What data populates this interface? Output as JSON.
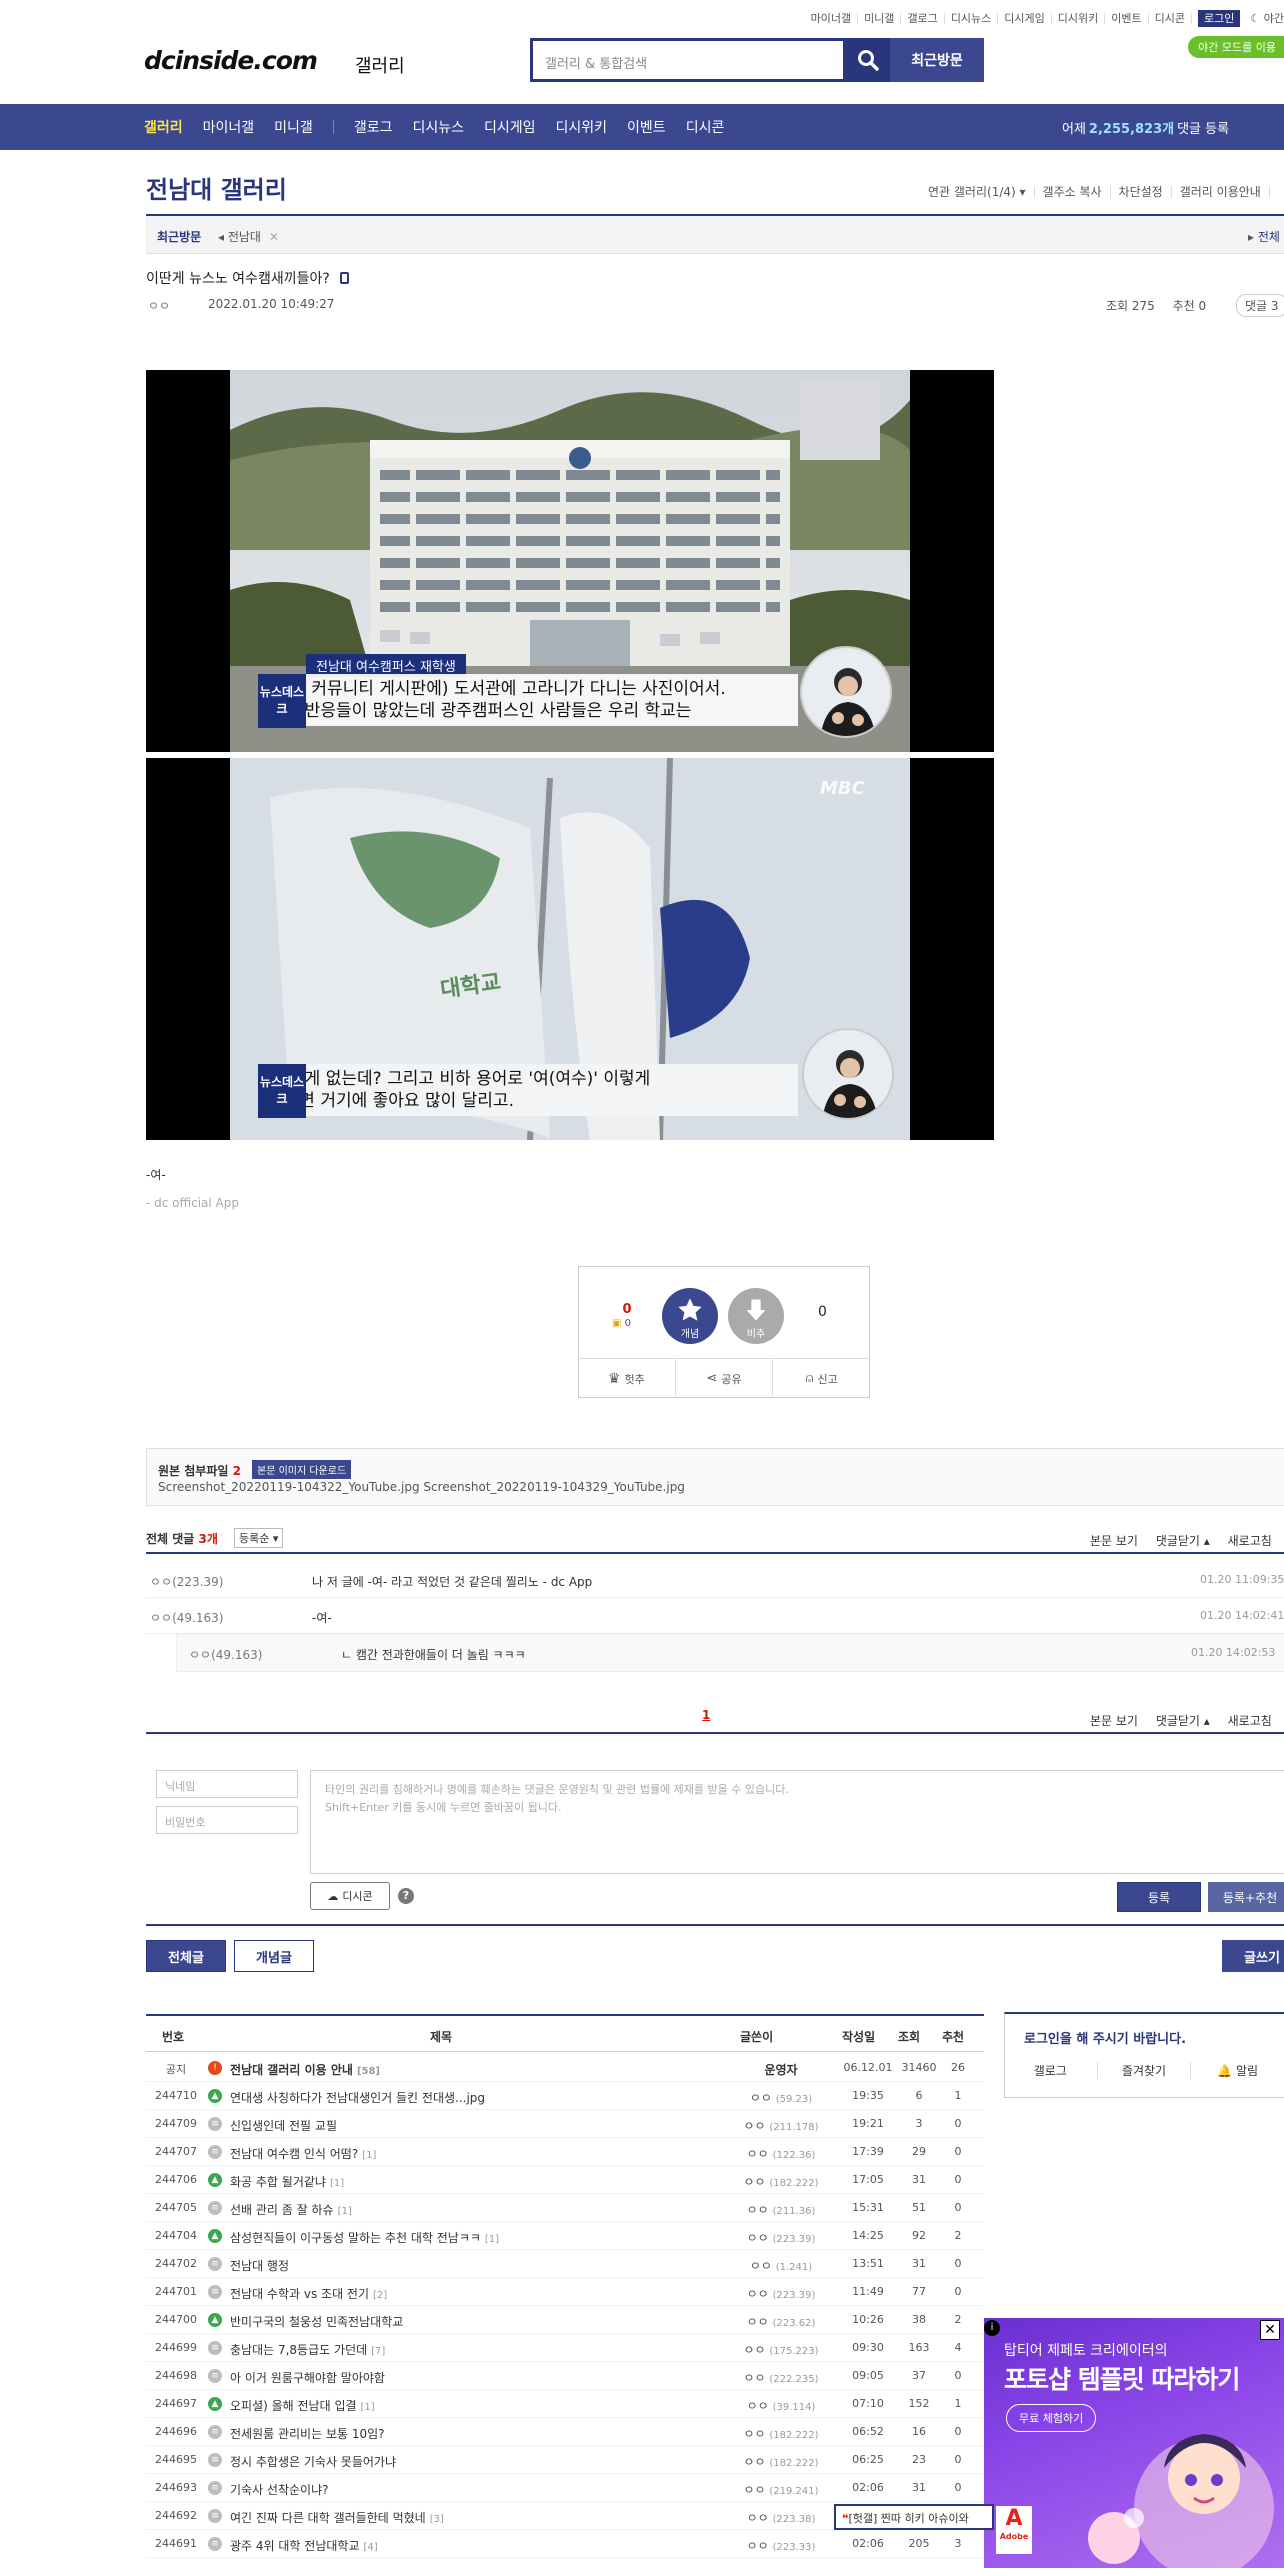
{
  "top_util": {
    "links": [
      "마이너갤",
      "미니갤",
      "갤로그",
      "디시뉴스",
      "디시게임",
      "디시위키",
      "이벤트",
      "디시콘"
    ],
    "login": "로그인",
    "night": "야간",
    "night_badge": "야간 모드를 이용"
  },
  "header": {
    "logo": "dcinside.com",
    "logo_sub": "갤러리",
    "search_placeholder": "갤러리 & 통합검색",
    "recent_visit": "최근방문"
  },
  "gnb": {
    "items": [
      "갤러리",
      "마이너갤",
      "미니갤",
      "갤로그",
      "디시뉴스",
      "디시게임",
      "디시위키",
      "이벤트",
      "디시콘"
    ],
    "visit_prefix": "어제",
    "visit_count": "2,255,823개",
    "visit_suffix": "댓글 등록"
  },
  "gallery": {
    "title": "전남대 갤러리",
    "links": [
      "연관 갤러리(1/4) ▾",
      "갤주소 복사",
      "차단설정",
      "갤러리 이용안내"
    ],
    "recent_label": "최근방문",
    "recent_item": "전남대",
    "recent_right": "전체"
  },
  "post": {
    "title": "이딴게 뉴스노 여수캠새끼들아?",
    "writer": "ㅇㅇ",
    "date": "2022.01.20 10:49:27",
    "views": "조회 275",
    "recommends": "추천 0",
    "reply_pill": "댓글 3",
    "image1": {
      "tag": "전남대 여수캠퍼스 재학생",
      "caption1": "(학교 커뮤니티 게시판에) 도서관에 고라니가 다니는 사진이어서.",
      "caption2": "좋은 반응들이 많았는데 광주캠퍼스인 사람들은 우리 학교는",
      "news_logo": "뉴스데스크"
    },
    "image2": {
      "watermark": "MBC",
      "caption1": "이런 게 없는데? 그리고 비하 용어로 '여(여수)' 이렇게",
      "caption2": "그러면 거기에 좋아요 많이 달리고.",
      "flag_text": "대학교",
      "news_logo": "뉴스데스크"
    },
    "body_text": "-여-",
    "body_sub": "- dc official App"
  },
  "recommend": {
    "count": "0",
    "fixed": "0",
    "rec_label": "개념",
    "nonrec_label": "비추",
    "nonrec_count": "0",
    "actions": [
      "헛추",
      "공유",
      "신고"
    ]
  },
  "attachments": {
    "title": "원본 첨부파일",
    "count": "2",
    "download": "본문 이미지 다운로드",
    "files": "Screenshot_20220119-104322_YouTube.jpg  Screenshot_20220119-104329_YouTube.jpg"
  },
  "comments": {
    "head": "전체 댓글",
    "count": "3개",
    "sort": "등록순 ▾",
    "right_links": [
      "본문 보기",
      "댓글닫기 ▴",
      "새로고침"
    ],
    "items": [
      {
        "writer": "ㅇㅇ(223.39)",
        "text": "나 저 글에 -여- 라고 적었던 것 같은데 찔리노 - dc App",
        "date": "01.20 11:09:35"
      },
      {
        "writer": "ㅇㅇ(49.163)",
        "text": "-여-",
        "date": "01.20 14:02:41"
      },
      {
        "writer": "ㅇㅇ(49.163)",
        "text": "ㄴ 캠간 전과한애들이 더 놀림 ㅋㅋㅋ",
        "date": "01.20 14:02:53"
      }
    ],
    "page": "1"
  },
  "write": {
    "nick_placeholder": "닉네임",
    "pw_placeholder": "비밀번호",
    "memo_line1": "타인의 권리를 침해하거나 명예를 훼손하는 댓글은 운영원칙 및 관련 법률에 제재를 받을 수 있습니다.",
    "memo_line2": "Shift+Enter 키를 동시에 누르면 줄바꿈이 됩니다.",
    "dccon": "디시콘",
    "help": "?",
    "submit": "등록",
    "submit_rec": "등록+추천"
  },
  "list_tabs": {
    "all": "전체글",
    "best": "개념글",
    "write": "글쓰기"
  },
  "list": {
    "headers": [
      "번호",
      "제목",
      "글쓴이",
      "작성일",
      "조회",
      "추천"
    ],
    "rows": [
      {
        "num": "공지",
        "icon": "notice",
        "title": "전남대 갤러리 이용 안내",
        "rc": "[58]",
        "writer": "운영자",
        "ip": "",
        "date": "06.12.01",
        "views": "31460",
        "rec": "26"
      },
      {
        "num": "244710",
        "icon": "img",
        "title": "연대생 사칭하다가 전남대생인거 들킨 전대생...jpg",
        "rc": "",
        "writer": "ㅇㅇ",
        "ip": "(59.23)",
        "date": "19:35",
        "views": "6",
        "rec": "1"
      },
      {
        "num": "244709",
        "icon": "txt",
        "title": "신입생인데 전필 교필",
        "rc": "",
        "writer": "ㅇㅇ",
        "ip": "(211.178)",
        "date": "19:21",
        "views": "3",
        "rec": "0"
      },
      {
        "num": "244707",
        "icon": "txt",
        "title": "전남대 여수캠 인식 어떰?",
        "rc": "[1]",
        "writer": "ㅇㅇ",
        "ip": "(122.36)",
        "date": "17:39",
        "views": "29",
        "rec": "0"
      },
      {
        "num": "244706",
        "icon": "img",
        "title": "화공 추합 될거같냐",
        "rc": "[1]",
        "writer": "ㅇㅇ",
        "ip": "(182.222)",
        "date": "17:05",
        "views": "31",
        "rec": "0"
      },
      {
        "num": "244705",
        "icon": "txt",
        "title": "선배 관리 좀 잘 하슈",
        "rc": "[1]",
        "writer": "ㅇㅇ",
        "ip": "(211.36)",
        "date": "15:31",
        "views": "51",
        "rec": "0"
      },
      {
        "num": "244704",
        "icon": "img",
        "title": "삼성현직들이 이구동성 말하는 추천 대학 전남ㅋㅋ",
        "rc": "[1]",
        "writer": "ㅇㅇ",
        "ip": "(223.39)",
        "date": "14:25",
        "views": "92",
        "rec": "2"
      },
      {
        "num": "244702",
        "icon": "txt",
        "title": "전남대 행정",
        "rc": "",
        "writer": "ㅇㅇ",
        "ip": "(1.241)",
        "date": "13:51",
        "views": "31",
        "rec": "0"
      },
      {
        "num": "244701",
        "icon": "txt",
        "title": "전남대 수학과 vs 조대 전기",
        "rc": "[2]",
        "writer": "ㅇㅇ",
        "ip": "(223.39)",
        "date": "11:49",
        "views": "77",
        "rec": "0"
      },
      {
        "num": "244700",
        "icon": "img",
        "title": "반미구국의 철웅성 민족전남대학교",
        "rc": "",
        "writer": "ㅇㅇ",
        "ip": "(223.62)",
        "date": "10:26",
        "views": "38",
        "rec": "2"
      },
      {
        "num": "244699",
        "icon": "txt",
        "title": "충남대는 7,8등급도 가던데",
        "rc": "[7]",
        "writer": "ㅇㅇ",
        "ip": "(175.223)",
        "date": "09:30",
        "views": "163",
        "rec": "4"
      },
      {
        "num": "244698",
        "icon": "txt",
        "title": "아 이거 원룸구해야함 말아야함",
        "rc": "",
        "writer": "ㅇㅇ",
        "ip": "(222.235)",
        "date": "09:05",
        "views": "37",
        "rec": "0"
      },
      {
        "num": "244697",
        "icon": "img",
        "title": "오피셜) 올해 전남대 입결",
        "rc": "[1]",
        "writer": "ㅇㅇ",
        "ip": "(39.114)",
        "date": "07:10",
        "views": "152",
        "rec": "1"
      },
      {
        "num": "244696",
        "icon": "txt",
        "title": "전세원룸 관리비는 보통 10임?",
        "rc": "",
        "writer": "ㅇㅇ",
        "ip": "(182.222)",
        "date": "06:52",
        "views": "16",
        "rec": "0"
      },
      {
        "num": "244695",
        "icon": "txt",
        "title": "정시 추합생은 기숙사 못들어가냐",
        "rc": "",
        "writer": "ㅇㅇ",
        "ip": "(182.222)",
        "date": "06:25",
        "views": "23",
        "rec": "0"
      },
      {
        "num": "244693",
        "icon": "txt",
        "title": "기숙사 선착순이냐?",
        "rc": "",
        "writer": "ㅇㅇ",
        "ip": "(219.241)",
        "date": "02:06",
        "views": "31",
        "rec": "0"
      },
      {
        "num": "244692",
        "icon": "txt",
        "title": "여긴 진짜 다른 대학 갤러들한테 먹혔네",
        "rc": "[3]",
        "writer": "ㅇㅇ",
        "ip": "(223.38)",
        "date": "01:56",
        "views": "84",
        "rec": "0"
      },
      {
        "num": "244691",
        "icon": "txt",
        "title": "광주 4위 대학 전남대학교",
        "rc": "[4]",
        "writer": "ㅇㅇ",
        "ip": "(223.33)",
        "date": "02:06",
        "views": "205",
        "rec": "3"
      }
    ]
  },
  "side": {
    "login_title": "로그인을 해 주시기 바랍니다.",
    "links": [
      "갤로그",
      "즐겨찾기",
      "🔔 알림"
    ]
  },
  "ad": {
    "line1": "탑티어 제페토 크리에이터의",
    "line2": "포토샵 템플릿 따라하기",
    "cta": "무료 체험하기",
    "brand": "Adobe",
    "close": "✕",
    "info": "i"
  },
  "overlay_tip": "[헛갤] 찐따 히키 아슈이와"
}
